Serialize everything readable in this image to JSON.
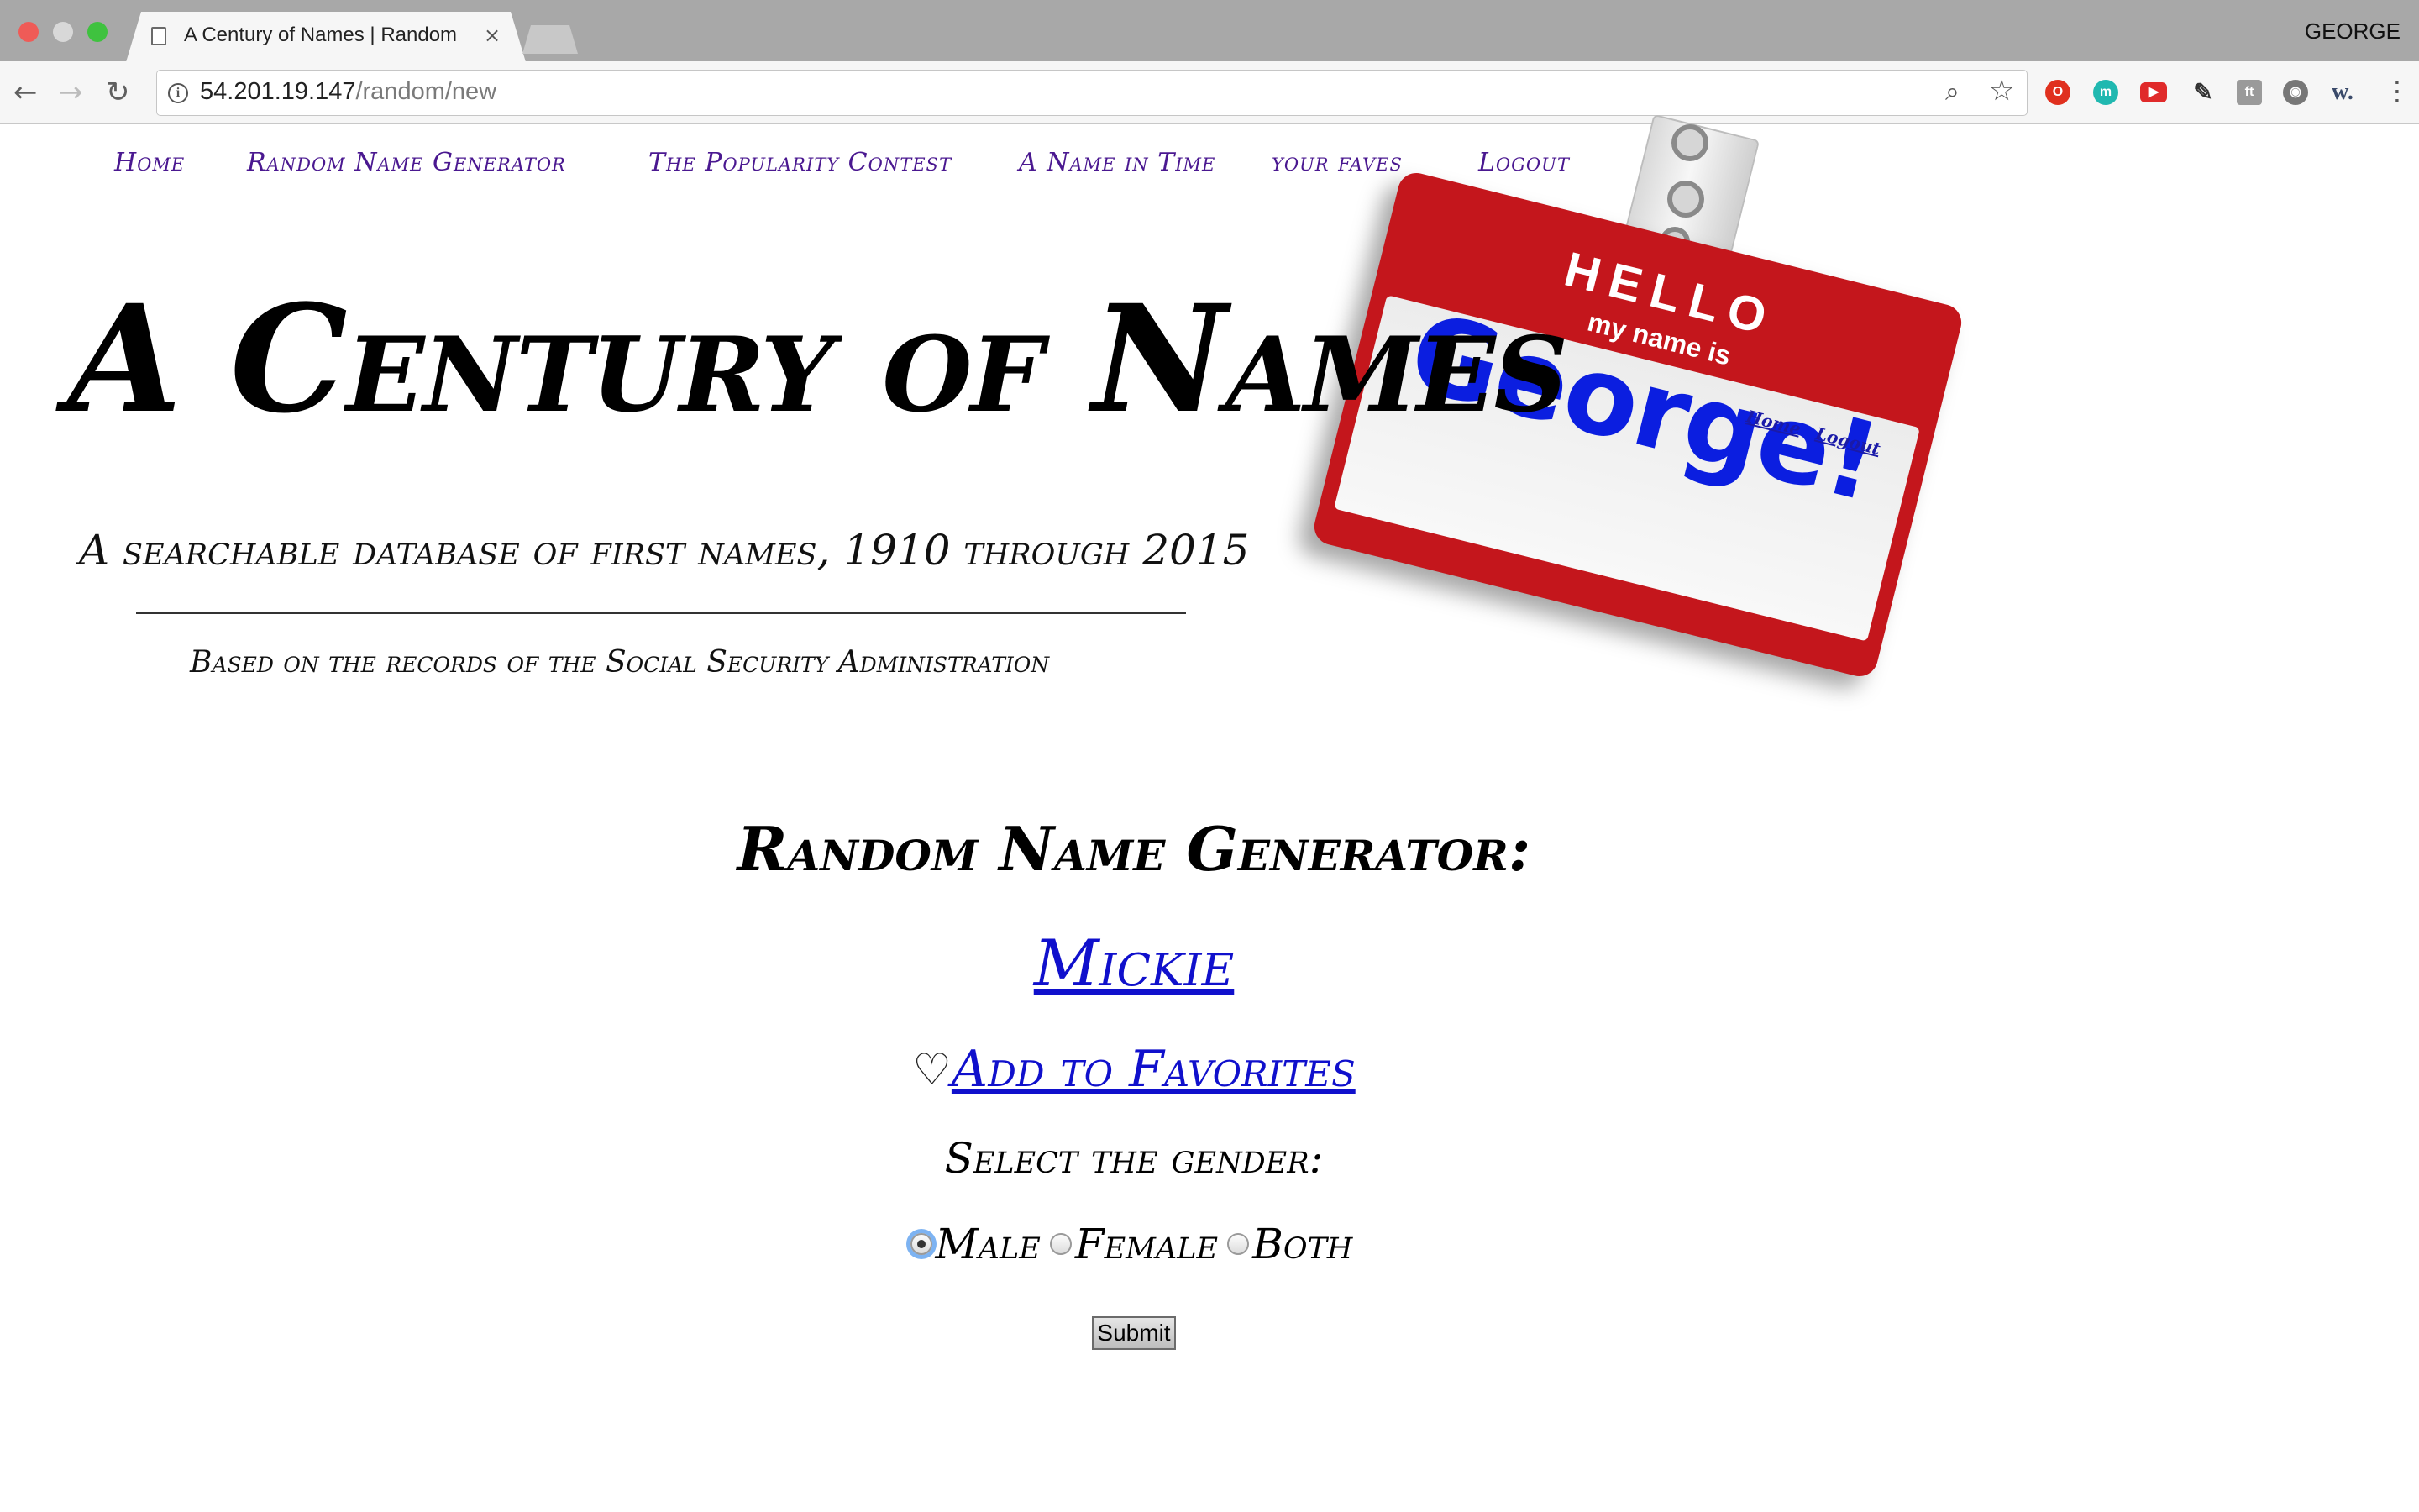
{
  "browser": {
    "tab_title": "A Century of Names | Random",
    "tab_close": "×",
    "profile": "GEORGE",
    "url_host": "54.201.19.147",
    "url_path": "/random/new",
    "back_glyph": "←",
    "forward_glyph": "→",
    "reload_glyph": "↻",
    "info_glyph": "i",
    "zoom_glyph": "⌕",
    "star_glyph": "☆",
    "menu_glyph": "⋮",
    "extensions": [
      {
        "name": "opera-extension-icon",
        "glyph": "O"
      },
      {
        "name": "m-extension-icon",
        "glyph": "m"
      },
      {
        "name": "youtube-extension-icon",
        "glyph": "▶"
      },
      {
        "name": "eyedropper-extension-icon",
        "glyph": "✎"
      },
      {
        "name": "font-extension-icon",
        "glyph": "ft"
      },
      {
        "name": "film-extension-icon",
        "glyph": "◉"
      },
      {
        "name": "w-extension-icon",
        "glyph": "w."
      }
    ]
  },
  "nav": {
    "home": "Home",
    "random": "Random Name Generator",
    "popularity": "The Popularity Contest",
    "name_in_time": "A Name in Time",
    "faves": "your faves",
    "logout": "Logout"
  },
  "hero": {
    "title": "A Century of Names",
    "subtitle": "A searchable database of first names, 1910 through 2015",
    "credit": "Based on the records of the Social Security Administration"
  },
  "name_tag": {
    "hello": "HELLO",
    "my_name_is": "my name is",
    "name": "George!",
    "home_link": "Home",
    "logout_link": "Logout"
  },
  "generator": {
    "heading": "Random Name Generator:",
    "name": "Mickie",
    "heart_glyph": "♡",
    "add_favorite": "Add to Favorites",
    "gender_label": "Select the gender:",
    "options": {
      "male": "Male",
      "female": "Female",
      "both": "Both"
    },
    "selected": "Male",
    "submit": "Submit"
  }
}
